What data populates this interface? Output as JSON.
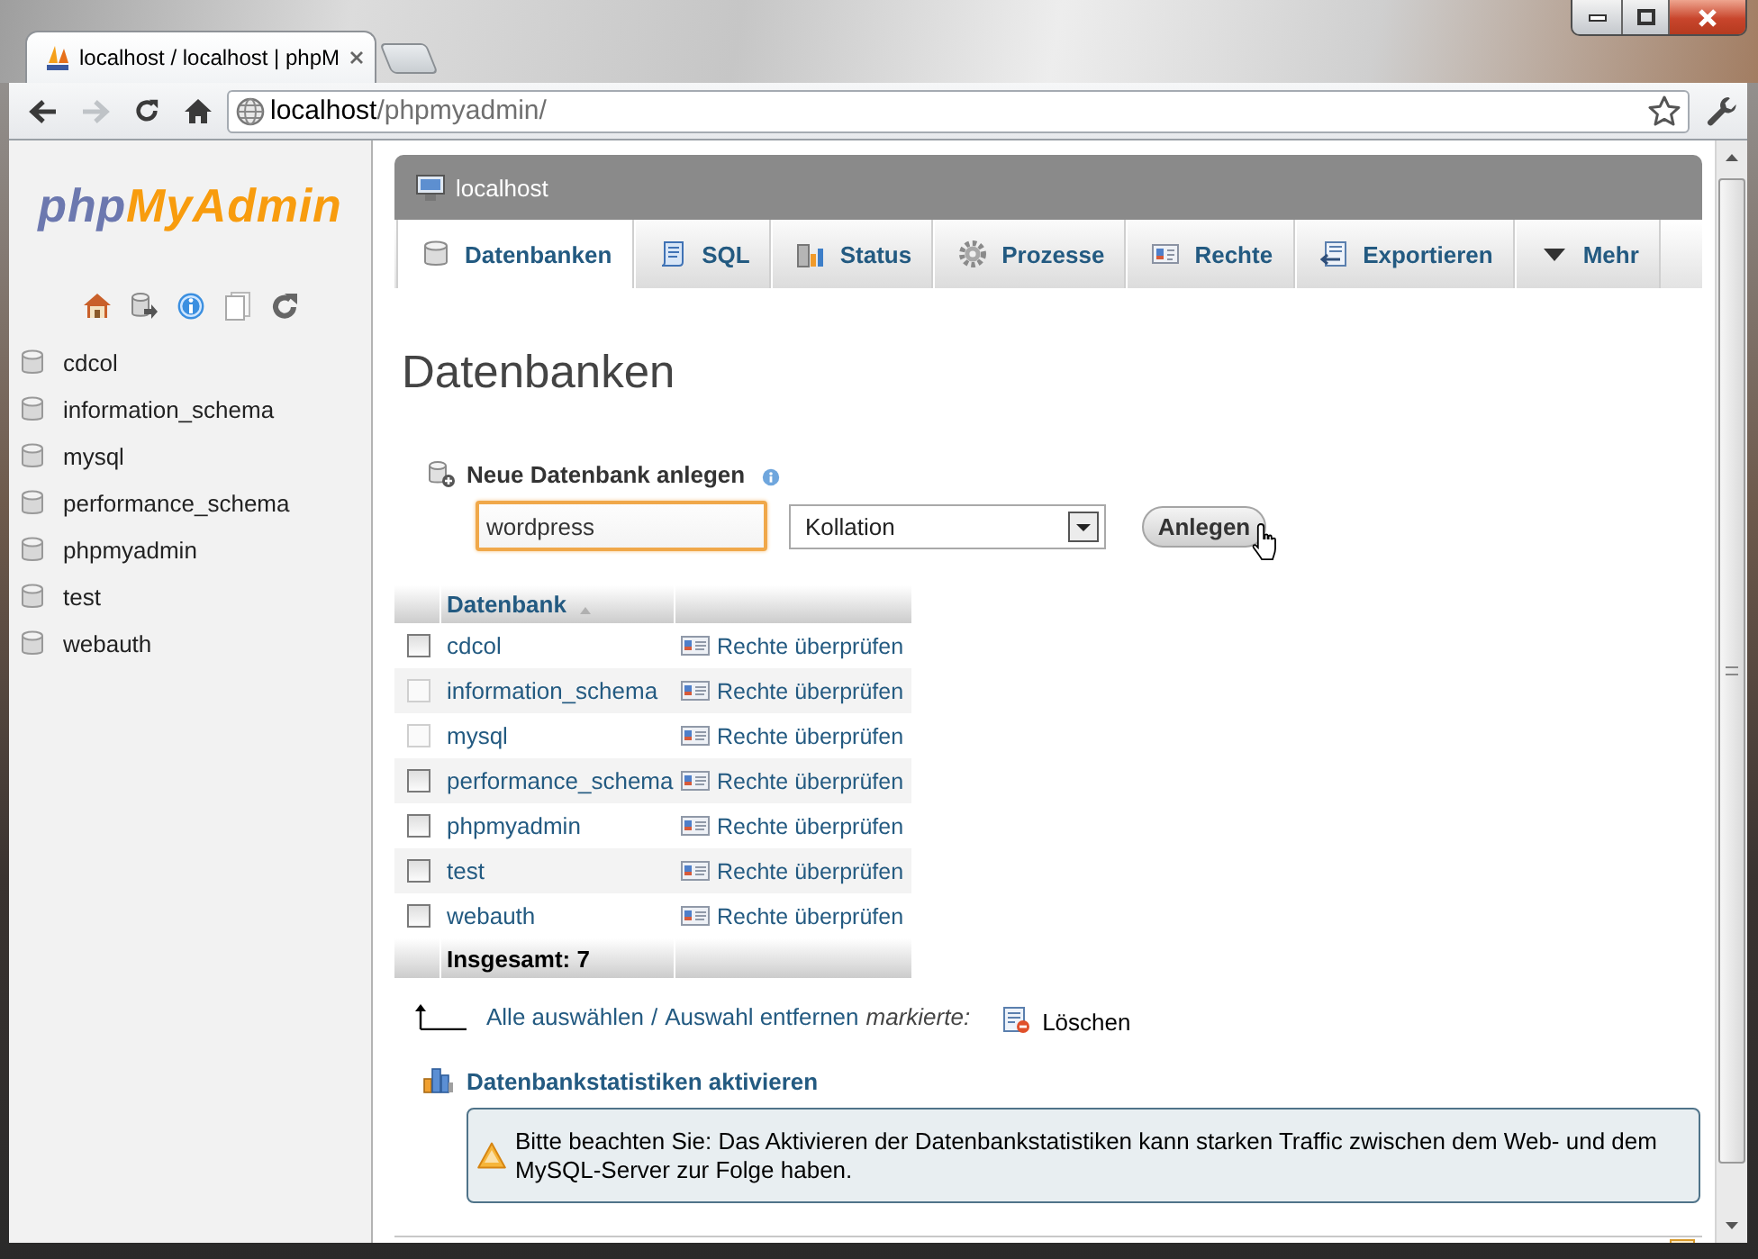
{
  "browser": {
    "tabs": [
      {
        "title": "localhost / localhost | phpM",
        "selected": true
      }
    ],
    "forward": {
      "disabled": true
    },
    "address": {
      "host": "localhost",
      "path": "/phpmyadmin/"
    }
  },
  "sidebar": {
    "logo": {
      "first": "php",
      "second": "MyAdmin"
    },
    "databases": [
      "cdcol",
      "information_schema",
      "mysql",
      "performance_schema",
      "phpmyadmin",
      "test",
      "webauth"
    ]
  },
  "server_bar": {
    "title": "localhost"
  },
  "tabs": [
    {
      "label": "Datenbanken",
      "selected": true
    },
    {
      "label": "SQL",
      "selected": false
    },
    {
      "label": "Status",
      "selected": false
    },
    {
      "label": "Prozesse",
      "selected": false
    },
    {
      "label": "Rechte",
      "selected": false
    },
    {
      "label": "Exportieren",
      "selected": false
    },
    {
      "label": "Mehr",
      "selected": false
    }
  ],
  "heading": "Datenbanken",
  "create_form": {
    "title": "Neue Datenbank anlegen",
    "name_field": {
      "value": "wordpress"
    },
    "collation_select": {
      "value": "Kollation"
    },
    "button": "Anlegen"
  },
  "table": {
    "columns": [
      "Datenbank"
    ],
    "rows": [
      {
        "name": "cdcol",
        "checked": false,
        "disabled": false,
        "action": "Rechte überprüfen"
      },
      {
        "name": "information_schema",
        "checked": false,
        "disabled": true,
        "action": "Rechte überprüfen"
      },
      {
        "name": "mysql",
        "checked": false,
        "disabled": true,
        "action": "Rechte überprüfen"
      },
      {
        "name": "performance_schema",
        "checked": false,
        "disabled": false,
        "action": "Rechte überprüfen"
      },
      {
        "name": "phpmyadmin",
        "checked": false,
        "disabled": false,
        "action": "Rechte überprüfen"
      },
      {
        "name": "test",
        "checked": false,
        "disabled": false,
        "action": "Rechte überprüfen"
      },
      {
        "name": "webauth",
        "checked": false,
        "disabled": false,
        "action": "Rechte überprüfen"
      }
    ],
    "footer": "Insgesamt: 7"
  },
  "bulk_actions": {
    "select_all": "Alle auswählen",
    "separator": "/",
    "deselect_all": "Auswahl entfernen",
    "with_selected": "markierte:",
    "delete": "Löschen"
  },
  "statistics": {
    "link": "Datenbankstatistiken aktivieren",
    "notice": "Bitte beachten Sie: Das Aktivieren der Datenbankstatistiken kann starken Traffic zwischen dem Web- und dem MySQL-Server zur Folge haben."
  }
}
